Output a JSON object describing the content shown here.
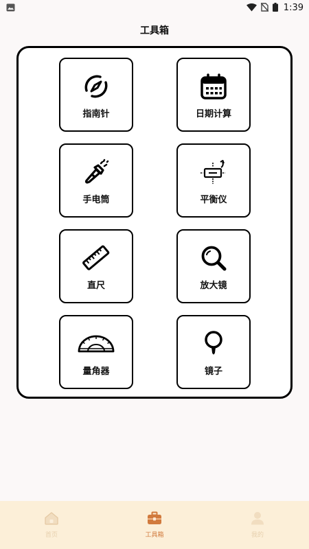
{
  "status_bar": {
    "time": "1:39",
    "icons": [
      "gallery-icon",
      "wifi-icon",
      "no-sim-icon",
      "battery-icon"
    ]
  },
  "header": {
    "title": "工具箱"
  },
  "tools": [
    {
      "label": "指南针",
      "icon": "compass-icon"
    },
    {
      "label": "日期计算",
      "icon": "calendar-icon"
    },
    {
      "label": "手电筒",
      "icon": "flashlight-icon"
    },
    {
      "label": "平衡仪",
      "icon": "level-icon"
    },
    {
      "label": "直尺",
      "icon": "ruler-icon"
    },
    {
      "label": "放大镜",
      "icon": "magnifier-icon"
    },
    {
      "label": "量角器",
      "icon": "protractor-icon"
    },
    {
      "label": "镜子",
      "icon": "mirror-icon"
    }
  ],
  "bottom_nav": {
    "items": [
      {
        "label": "首页",
        "icon": "home-icon",
        "active": false
      },
      {
        "label": "工具箱",
        "icon": "toolbox-icon",
        "active": true
      },
      {
        "label": "我的",
        "icon": "user-icon",
        "active": false
      }
    ]
  },
  "colors": {
    "nav_background": "#fcefd8",
    "nav_active": "#d17a3d",
    "nav_inactive": "#e7d0ae"
  }
}
